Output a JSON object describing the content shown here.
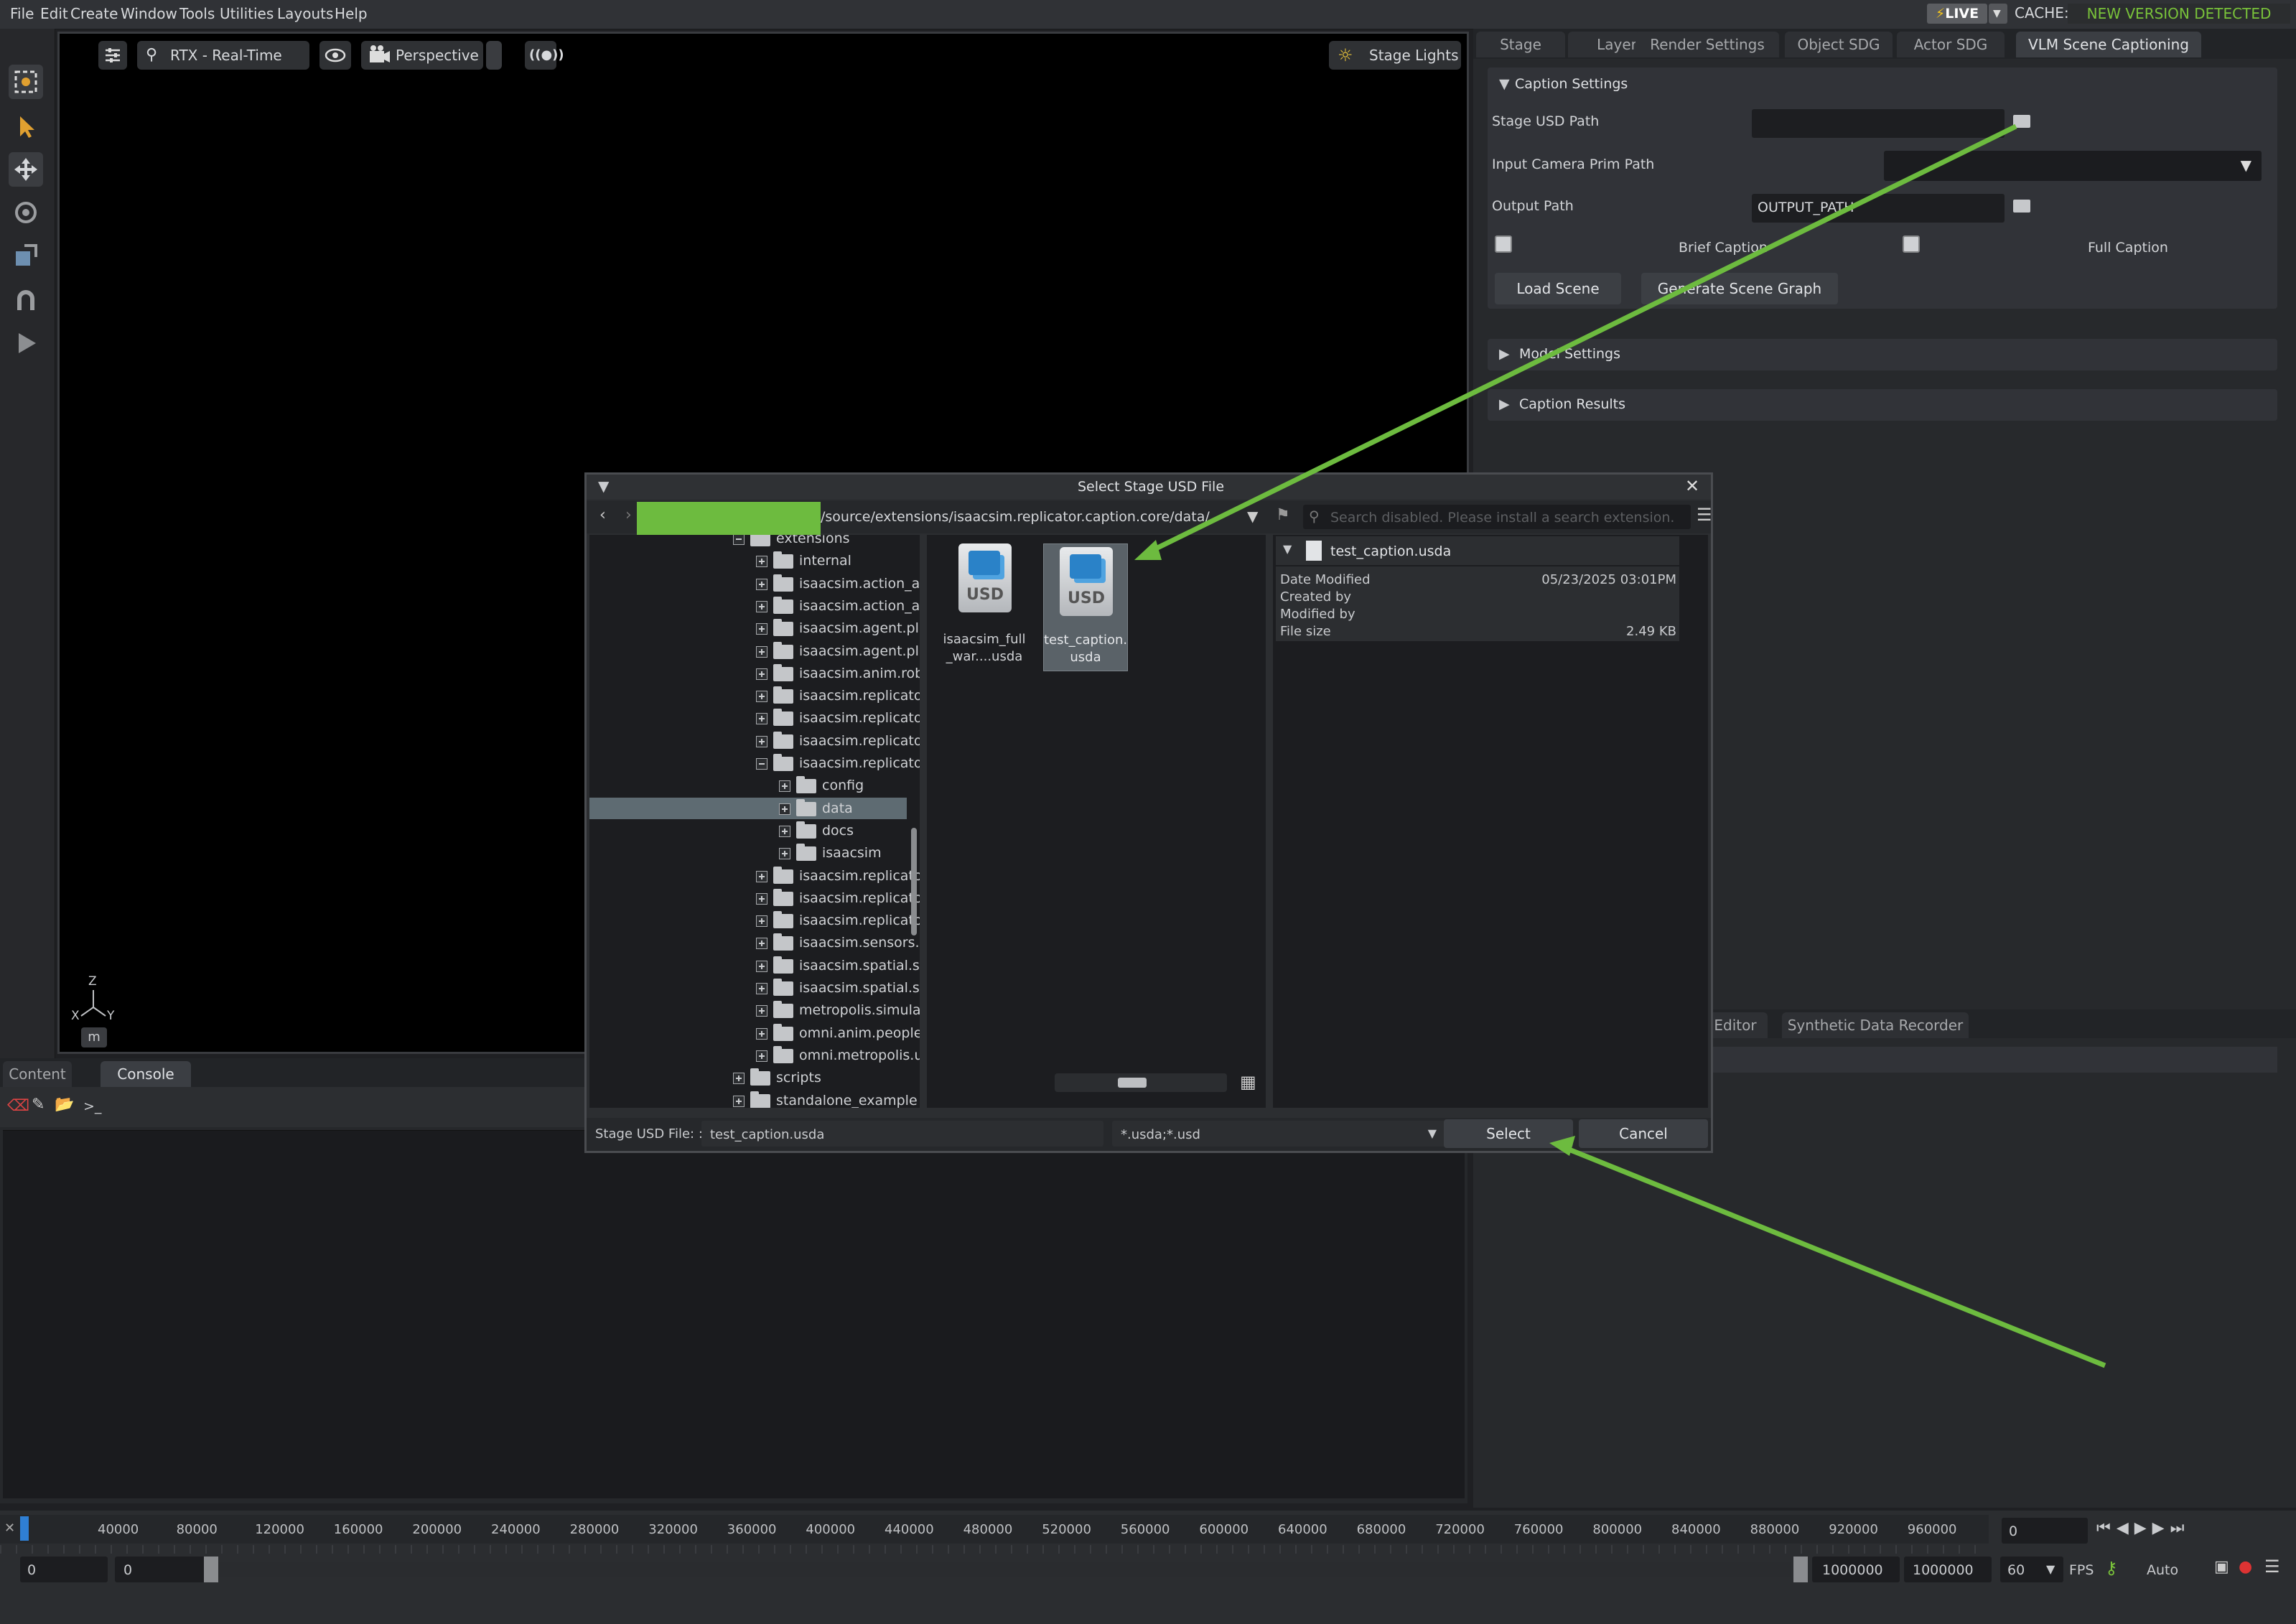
{
  "menubar": {
    "items": [
      "File",
      "Edit",
      "Create",
      "Window",
      "Tools",
      "Utilities",
      "Layouts",
      "Help"
    ],
    "live": "LIVE",
    "cache": "CACHE:",
    "new_version": "NEW VERSION DETECTED"
  },
  "viewport": {
    "renderer": "RTX - Real-Time",
    "camera": "Perspective",
    "stage_lights": "Stage Lights",
    "axis_z": "Z",
    "axis_x": "X",
    "axis_y": "Y",
    "unit": "m"
  },
  "right_panel": {
    "tabs": [
      "Stage",
      "Layer",
      "Render Settings",
      "Object SDG",
      "Actor SDG",
      "VLM Scene Captioning"
    ],
    "caption_settings": {
      "title": "Caption Settings",
      "stage_usd_path_label": "Stage USD Path",
      "input_camera_label": "Input Camera Prim Path",
      "output_path_label": "Output Path",
      "output_path_value": "OUTPUT_PATH",
      "brief_caption": "Brief Caption",
      "full_caption": "Full Caption",
      "load_scene": "Load Scene",
      "generate_scene_graph": "Generate Scene Graph"
    },
    "model_settings": "Model Settings",
    "caption_results": "Caption Results",
    "lower_tabs": [
      "Editor",
      "Synthetic Data Recorder"
    ]
  },
  "bottom_left": {
    "tabs": [
      "Content",
      "Console"
    ],
    "prompt": ">_"
  },
  "dialog": {
    "title": "Select Stage USD File",
    "path": "/source/extensions/isaacsim.replicator.caption.core/data/",
    "search_placeholder": "Search disabled. Please install a search extension.",
    "tree": [
      {
        "label": "extensions",
        "depth": 0,
        "state": "open"
      },
      {
        "label": "internal",
        "depth": 1,
        "state": "closed"
      },
      {
        "label": "isaacsim.action_a",
        "depth": 1,
        "state": "closed"
      },
      {
        "label": "isaacsim.action_a",
        "depth": 1,
        "state": "closed"
      },
      {
        "label": "isaacsim.agent.pl",
        "depth": 1,
        "state": "closed"
      },
      {
        "label": "isaacsim.agent.pl",
        "depth": 1,
        "state": "closed"
      },
      {
        "label": "isaacsim.anim.rob",
        "depth": 1,
        "state": "closed"
      },
      {
        "label": "isaacsim.replicato",
        "depth": 1,
        "state": "closed"
      },
      {
        "label": "isaacsim.replicato",
        "depth": 1,
        "state": "closed"
      },
      {
        "label": "isaacsim.replicato",
        "depth": 1,
        "state": "closed"
      },
      {
        "label": "isaacsim.replicato",
        "depth": 1,
        "state": "open"
      },
      {
        "label": "config",
        "depth": 2,
        "state": "closed"
      },
      {
        "label": "data",
        "depth": 2,
        "state": "selected"
      },
      {
        "label": "docs",
        "depth": 2,
        "state": "closed"
      },
      {
        "label": "isaacsim",
        "depth": 2,
        "state": "closed"
      },
      {
        "label": "isaacsim.replicato",
        "depth": 1,
        "state": "closed"
      },
      {
        "label": "isaacsim.replicato",
        "depth": 1,
        "state": "closed"
      },
      {
        "label": "isaacsim.replicato",
        "depth": 1,
        "state": "closed"
      },
      {
        "label": "isaacsim.sensors.",
        "depth": 1,
        "state": "closed"
      },
      {
        "label": "isaacsim.spatial.s",
        "depth": 1,
        "state": "closed"
      },
      {
        "label": "isaacsim.spatial.s",
        "depth": 1,
        "state": "closed"
      },
      {
        "label": "metropolis.simula",
        "depth": 1,
        "state": "closed"
      },
      {
        "label": "omni.anim.people",
        "depth": 1,
        "state": "closed"
      },
      {
        "label": "omni.metropolis.u",
        "depth": 1,
        "state": "closed"
      },
      {
        "label": "scripts",
        "depth": 0,
        "state": "closed"
      },
      {
        "label": "standalone_example",
        "depth": 0,
        "state": "closed"
      }
    ],
    "files": [
      {
        "label1": "isaacsim_full",
        "label2": "_war....usda",
        "selected": false
      },
      {
        "label1": "test_caption.",
        "label2": "usda",
        "selected": true
      }
    ],
    "usd_badge": "USD",
    "details": {
      "filename": "test_caption.usda",
      "rows": [
        {
          "key": "Date Modified",
          "value": "05/23/2025 03:01PM"
        },
        {
          "key": "Created by",
          "value": ""
        },
        {
          "key": "Modified by",
          "value": ""
        },
        {
          "key": "File size",
          "value": "2.49 KB"
        }
      ]
    },
    "footer": {
      "file_label": "Stage USD File: :",
      "file_value": "test_caption.usda",
      "filter": "*.usda;*.usd",
      "select": "Select",
      "cancel": "Cancel"
    }
  },
  "timeline": {
    "ticks": [
      "40000",
      "80000",
      "120000",
      "160000",
      "200000",
      "240000",
      "280000",
      "320000",
      "360000",
      "400000",
      "440000",
      "480000",
      "520000",
      "560000",
      "600000",
      "640000",
      "680000",
      "720000",
      "760000",
      "800000",
      "840000",
      "880000",
      "920000",
      "960000"
    ],
    "current_frame": "0",
    "start": "0",
    "start2": "0",
    "end": "1000000",
    "end2": "1000000",
    "fps_value": "60",
    "fps_label": "FPS",
    "auto": "Auto"
  },
  "colors": {
    "accent_green": "#79c23a",
    "annotation_green": "#6dbb3f"
  }
}
